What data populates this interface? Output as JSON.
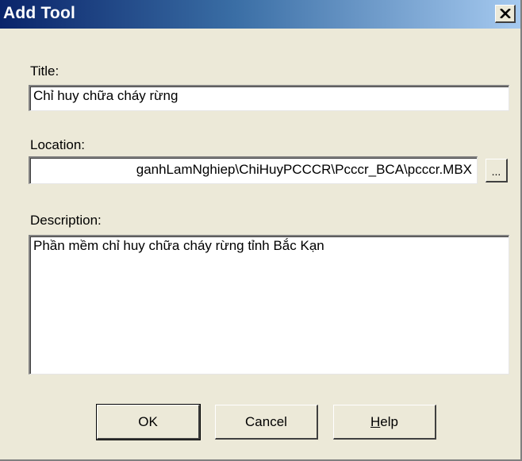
{
  "window": {
    "title": "Add Tool",
    "close_icon": "close-icon"
  },
  "form": {
    "title_label": "Title:",
    "title_value": "Chỉ huy chữa cháy rừng",
    "location_label": "Location:",
    "location_value": "ganhLamNghiep\\ChiHuyPCCCR\\Pcccr_BCA\\pcccr.MBX",
    "browse_label": "...",
    "description_label": "Description:",
    "description_value": "Phần mềm chỉ huy chữa cháy rừng tỉnh Bắc Kạn"
  },
  "buttons": {
    "ok_label": "OK",
    "cancel_label": "Cancel",
    "help_mnemonic": "H",
    "help_rest": "elp"
  },
  "colors": {
    "titlebar_start": "#0a246a",
    "titlebar_end": "#a6caf0",
    "dialog_bg": "#ece9d8"
  }
}
